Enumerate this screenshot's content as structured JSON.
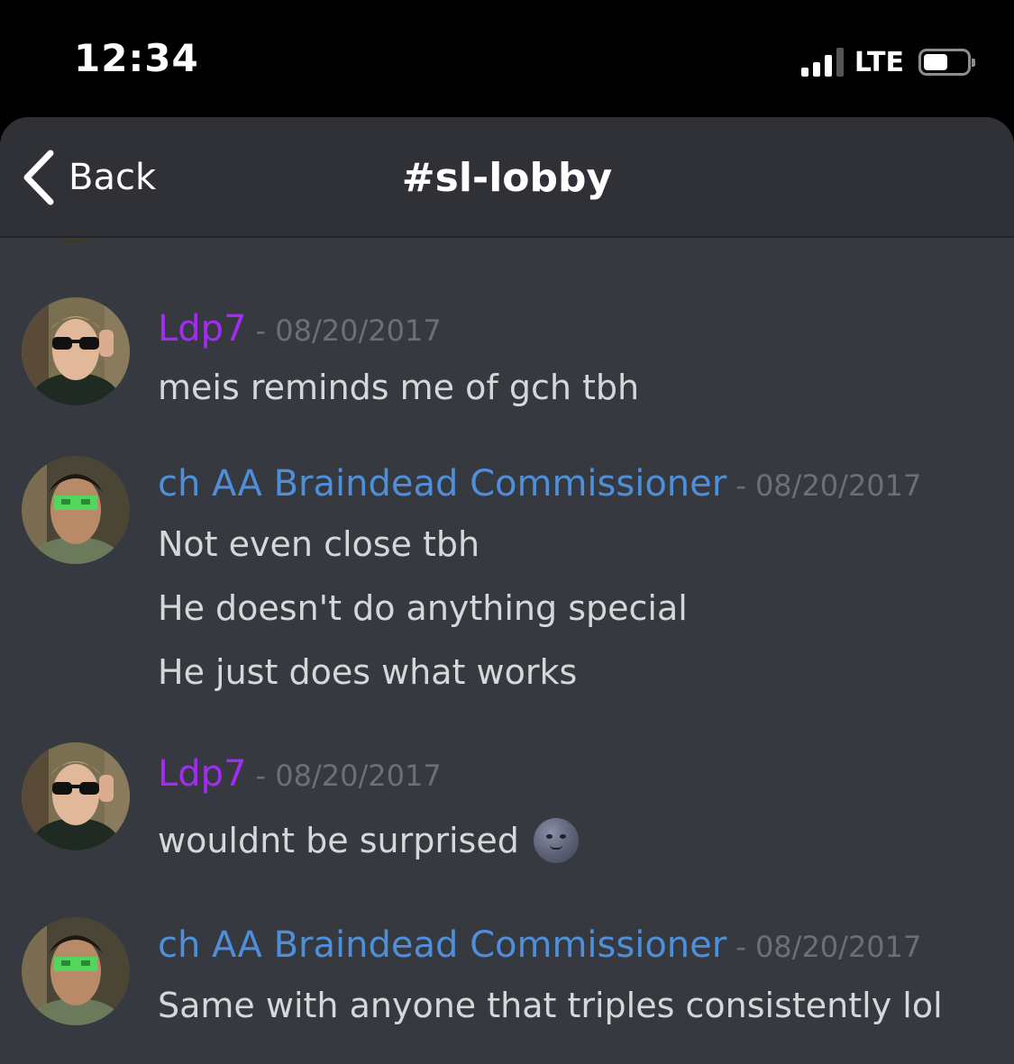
{
  "status_bar": {
    "time": "12:34",
    "network": "LTE",
    "signal_bars_active": 3,
    "signal_bars_total": 4,
    "battery_level": 0.45
  },
  "nav": {
    "back_label": "Back",
    "back_icon": "chevron-left-icon",
    "channel": "#sl-lobby"
  },
  "colors": {
    "background": "#36393f",
    "header": "#2f3136",
    "username_ldp7": "#a32cf2",
    "username_ch": "#4f8fda",
    "timestamp": "#6c6f75",
    "message_text": "#d6d7d9"
  },
  "messages": [
    {
      "username": "Ldp7",
      "timestamp": "- 08/20/2017",
      "lines": [
        "meis reminds me of gch tbh"
      ]
    },
    {
      "username": "ch AA Braindead Commissioner",
      "timestamp": "- 08/20/2017",
      "lines": [
        "Not even close tbh",
        "He doesn't do anything special",
        "He just does what works"
      ]
    },
    {
      "username": "Ldp7",
      "timestamp": "- 08/20/2017",
      "lines": [
        "wouldnt be surprised"
      ],
      "emoji": "new-moon-face-icon"
    },
    {
      "username": "ch AA Braindead Commissioner",
      "timestamp": "- 08/20/2017",
      "lines": [
        "Same with anyone that triples  consistently lol"
      ]
    }
  ]
}
